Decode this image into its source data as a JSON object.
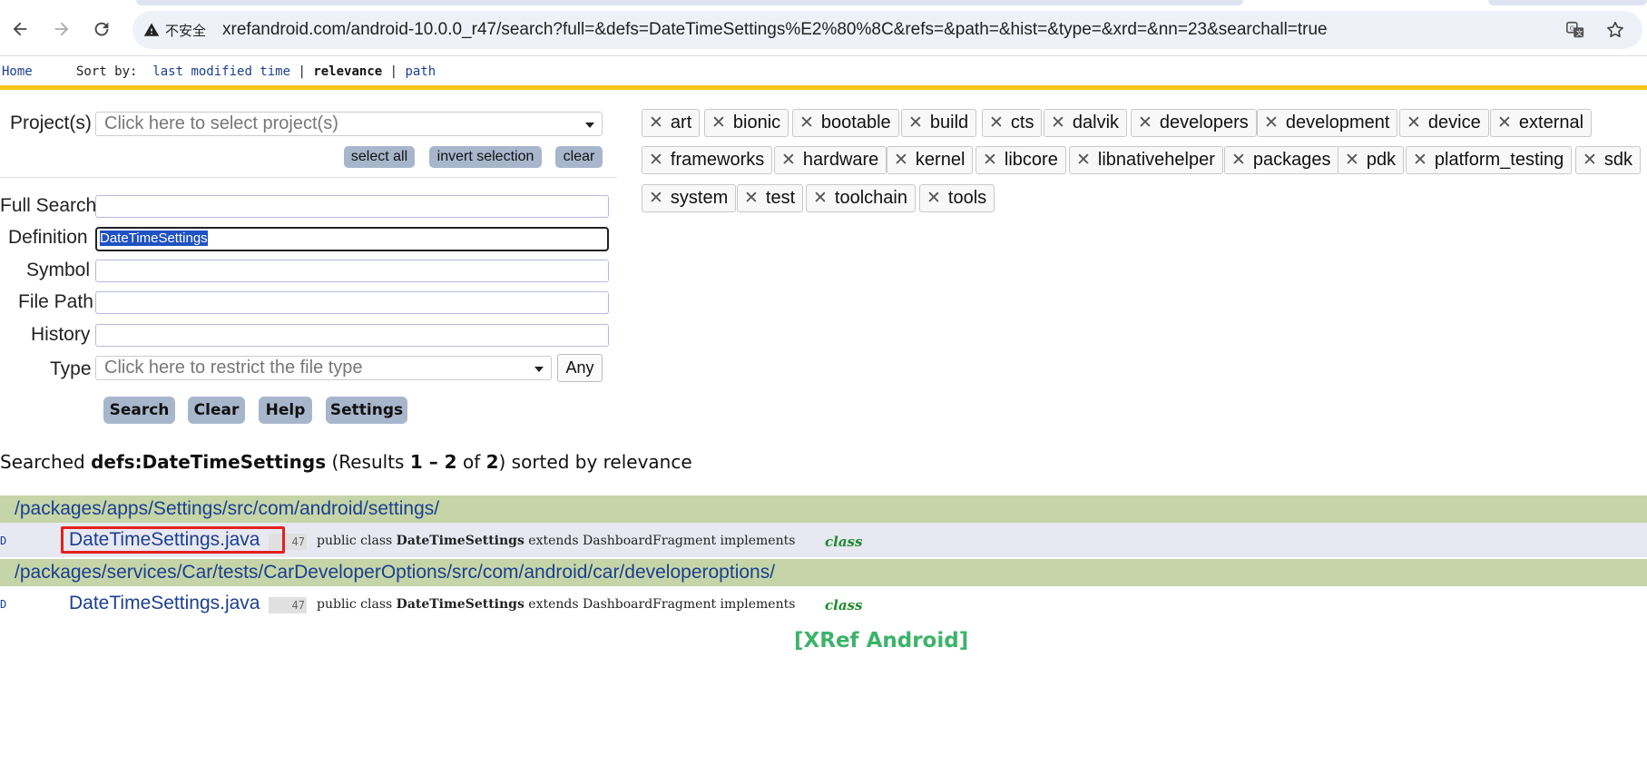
{
  "browser": {
    "security_label": "不安全",
    "url": "xrefandroid.com/android-10.0.0_r47/search?full=&defs=DateTimeSettings%E2%80%8C&refs=&path=&hist=&type=&xrd=&nn=23&searchall=true",
    "icons": [
      "back-icon",
      "forward-icon",
      "reload-icon",
      "warning-icon",
      "translate-icon",
      "star-icon"
    ]
  },
  "topbar": {
    "home": "Home",
    "sort_label": "Sort by:",
    "sort_last_modified": "last modified time",
    "sort_relevance": "relevance",
    "sort_path": "path",
    "separator": "|"
  },
  "form": {
    "projects_label": "Project(s)",
    "projects_placeholder": "Click here to select project(s)",
    "select_all": "select all",
    "invert_selection": "invert selection",
    "clear_small": "clear",
    "full_search_label": "Full Search",
    "full_search_value": "",
    "definition_label": "Definition",
    "definition_value": "DateTimeSettings",
    "symbol_label": "Symbol",
    "symbol_value": "",
    "file_path_label": "File Path",
    "file_path_value": "",
    "history_label": "History",
    "history_value": "",
    "type_label": "Type",
    "type_placeholder": "Click here to restrict the file type",
    "any_button": "Any",
    "search_button": "Search",
    "clear_button": "Clear",
    "help_button": "Help",
    "settings_button": "Settings"
  },
  "projects": {
    "chips": [
      "art",
      "bionic",
      "bootable",
      "build",
      "cts",
      "dalvik",
      "developers",
      "development",
      "device",
      "external",
      "frameworks",
      "hardware",
      "kernel",
      "libcore",
      "libnativehelper",
      "packages",
      "pdk",
      "platform_testing",
      "sdk",
      "system",
      "test",
      "toolchain",
      "tools"
    ],
    "remove_glyph": "✕"
  },
  "results": {
    "summary_prefix": "Searched ",
    "summary_query": "defs:DateTimeSettings",
    "summary_mid1": " (Results ",
    "summary_range": "1 – 2",
    "summary_mid2": " of ",
    "summary_total": "2",
    "summary_suffix": ") sorted by relevance",
    "groups": [
      {
        "dir": "/packages/apps/Settings/src/com/android/settings/",
        "file": "DateTimeSettings.java",
        "marker": "D",
        "line": "47",
        "code_pre": "public class ",
        "code_bold": "DateTimeSettings",
        "code_post": " extends DashboardFragment implements",
        "kind": "class"
      },
      {
        "dir": "/packages/services/Car/tests/CarDeveloperOptions/src/com/android/car/developeroptions/",
        "file": "DateTimeSettings.java",
        "marker": "D",
        "line": "47",
        "code_pre": "public class ",
        "code_bold": "DateTimeSettings",
        "code_post": " extends DashboardFragment implements",
        "kind": "class"
      }
    ]
  },
  "footer": "[XRef Android]"
}
